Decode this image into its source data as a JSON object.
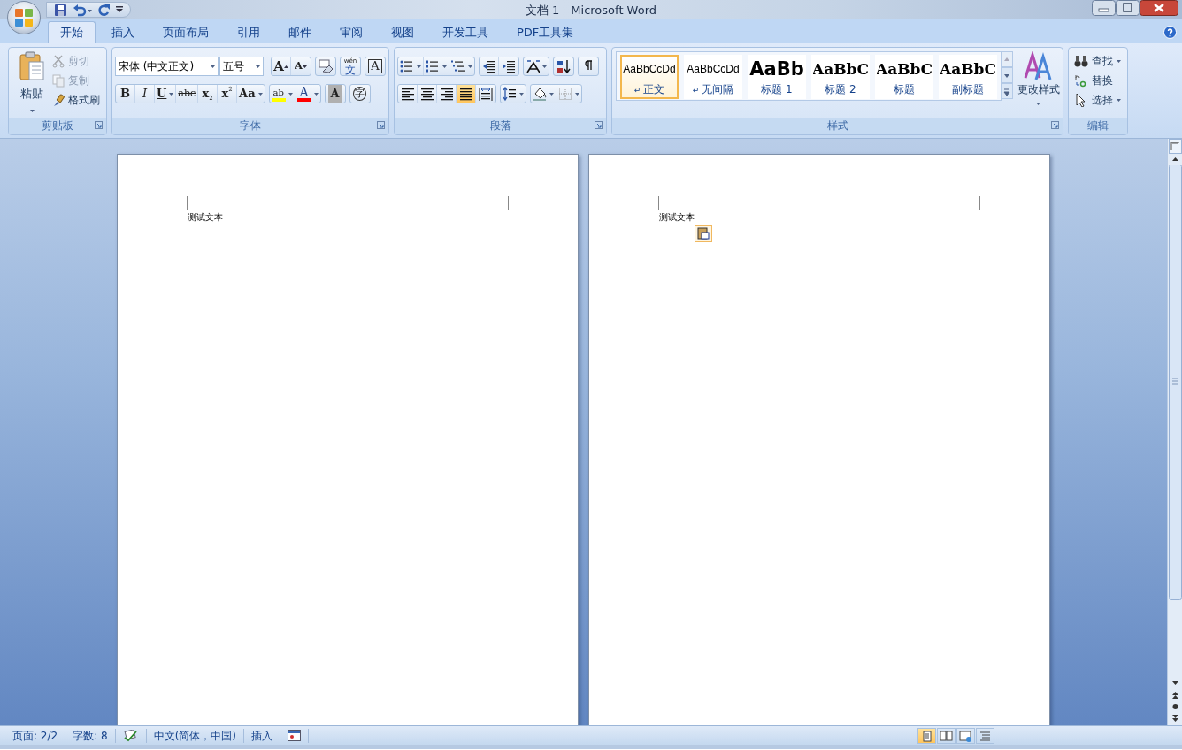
{
  "window": {
    "title": "文档 1 - Microsoft Word"
  },
  "tabs": [
    {
      "label": "开始",
      "selected": true
    },
    {
      "label": "插入",
      "selected": false
    },
    {
      "label": "页面布局",
      "selected": false
    },
    {
      "label": "引用",
      "selected": false
    },
    {
      "label": "邮件",
      "selected": false
    },
    {
      "label": "审阅",
      "selected": false
    },
    {
      "label": "视图",
      "selected": false
    },
    {
      "label": "开发工具",
      "selected": false
    },
    {
      "label": "PDF工具集",
      "selected": false
    }
  ],
  "clipboard": {
    "label": "剪贴板",
    "launcher": true,
    "paste": {
      "label": "粘贴"
    },
    "commands": [
      {
        "kind": "cut",
        "label": "剪切",
        "disabled": true
      },
      {
        "kind": "copy",
        "label": "复制",
        "disabled": true
      },
      {
        "kind": "format-painter",
        "label": "格式刷",
        "disabled": false
      }
    ]
  },
  "font": {
    "label": "字体",
    "launcher": true,
    "font_name": "宋体 (中文正文)",
    "font_size": "五号",
    "row1": [
      [
        {
          "kind": "grow",
          "label": "A"
        },
        {
          "kind": "shrink",
          "label": "A"
        }
      ],
      [
        {
          "kind": "clear"
        }
      ],
      [
        {
          "kind": "phonetic",
          "ruby": "wén",
          "label": "文"
        }
      ],
      [
        {
          "kind": "border",
          "label": "A"
        }
      ]
    ],
    "row2": [
      [
        {
          "kind": "bold",
          "label": "B"
        },
        {
          "kind": "italic",
          "label": "I"
        },
        {
          "kind": "underline",
          "label": "U",
          "dropdown": true
        },
        {
          "kind": "strike",
          "label": "abc"
        },
        {
          "kind": "subscript",
          "label": "x",
          "script": "2"
        },
        {
          "kind": "superscript",
          "label": "x",
          "script": "2"
        },
        {
          "kind": "case",
          "label": "Aa",
          "dropdown": true
        }
      ],
      [
        {
          "kind": "highlight",
          "label": "ab",
          "dropdown": true,
          "color": "#ffff00"
        },
        {
          "kind": "font-color",
          "label": "A",
          "dropdown": true,
          "color": "#ff0000"
        }
      ],
      [
        {
          "kind": "shading",
          "label": "A"
        }
      ],
      [
        {
          "kind": "enclose",
          "label": "字"
        }
      ]
    ]
  },
  "paragraph": {
    "label": "段落",
    "launcher": true,
    "row1": [
      [
        {
          "kind": "bullets",
          "dropdown": true
        },
        {
          "kind": "numbering",
          "dropdown": true
        },
        {
          "kind": "multilevel",
          "dropdown": true
        }
      ],
      [
        {
          "kind": "outdent"
        },
        {
          "kind": "indent"
        }
      ],
      [
        {
          "kind": "asian-layout",
          "dropdown": true
        }
      ],
      [
        {
          "kind": "sort"
        }
      ],
      [
        {
          "kind": "marks"
        }
      ]
    ],
    "row2": [
      [
        {
          "kind": "align-left",
          "selected": false
        },
        {
          "kind": "align-center",
          "selected": false
        },
        {
          "kind": "align-right",
          "selected": false
        },
        {
          "kind": "justify",
          "selected": true
        },
        {
          "kind": "distribute",
          "selected": false
        }
      ],
      [
        {
          "kind": "line-spacing",
          "dropdown": true
        }
      ],
      [
        {
          "kind": "fill",
          "dropdown": true
        },
        {
          "kind": "borders",
          "dropdown": true
        }
      ]
    ]
  },
  "styles": {
    "label": "样式",
    "launcher": true,
    "gallery": [
      {
        "kind": "normal",
        "preview": "AaBbCcDd",
        "marker": "↵",
        "name": "正文",
        "selected": true
      },
      {
        "kind": "normal",
        "preview": "AaBbCcDd",
        "marker": "↵",
        "name": "无间隔",
        "selected": false
      },
      {
        "kind": "heading1",
        "preview": "AaBb",
        "name": "标题 1",
        "selected": false
      },
      {
        "kind": "heading2",
        "preview": "AaBbC",
        "name": "标题 2",
        "selected": false
      },
      {
        "kind": "title",
        "preview": "AaBbC",
        "name": "标题",
        "selected": false
      },
      {
        "kind": "subtitle",
        "preview": "AaBbC",
        "name": "副标题",
        "selected": false
      }
    ],
    "change": {
      "label": "更改样式"
    }
  },
  "editing": {
    "label": "编辑",
    "launcher": false,
    "commands": [
      {
        "kind": "find",
        "label": "查找",
        "dropdown": true
      },
      {
        "kind": "replace",
        "label": "替换",
        "dropdown": false
      },
      {
        "kind": "select",
        "label": "选择",
        "dropdown": true
      }
    ]
  },
  "pages": [
    {
      "lines": [
        "测试文本"
      ],
      "paste_options": false
    },
    {
      "lines": [
        "测试文本"
      ],
      "paste_options": true
    }
  ],
  "status_bar": {
    "items": [
      {
        "kind": "text",
        "label": "页面: 2/2"
      },
      {
        "kind": "text",
        "label": "字数: 8"
      },
      {
        "kind": "proofing"
      },
      {
        "kind": "text",
        "label": "中文(简体，中国)"
      },
      {
        "kind": "text",
        "label": "插入"
      },
      {
        "kind": "macro"
      }
    ],
    "views": [
      {
        "kind": "print",
        "selected": true
      },
      {
        "kind": "reading",
        "selected": false
      },
      {
        "kind": "web",
        "selected": false
      },
      {
        "kind": "outline",
        "selected": false
      }
    ]
  }
}
